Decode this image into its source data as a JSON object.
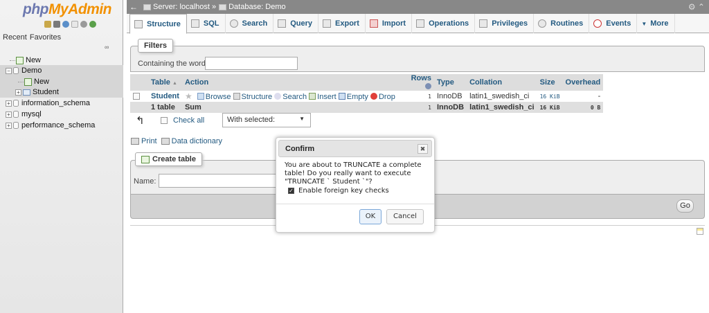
{
  "nav": {
    "logo_php": "php",
    "logo_myadmin": "MyAdmin",
    "tabs": [
      "Recent",
      "Favorites"
    ],
    "tree": {
      "new": "New",
      "demo": "Demo",
      "demo_new": "New",
      "student": "Student",
      "db1": "information_schema",
      "db2": "mysql",
      "db3": "performance_schema"
    }
  },
  "breadcrumb": {
    "server": "Server: localhost »",
    "database": "Database: Demo"
  },
  "tabs": [
    "Structure",
    "SQL",
    "Search",
    "Query",
    "Export",
    "Import",
    "Operations",
    "Privileges",
    "Routines",
    "Events",
    "More"
  ],
  "filters": {
    "legend": "Filters",
    "label": "Containing the word:",
    "value": ""
  },
  "table": {
    "headers": {
      "table": "Table",
      "sort": "▲",
      "action": "Action",
      "rows": "Rows",
      "type": "Type",
      "collation": "Collation",
      "size": "Size",
      "overhead": "Overhead"
    },
    "row": {
      "name": "Student",
      "browse": "Browse",
      "structure": "Structure",
      "search": "Search",
      "insert": "Insert",
      "empty": "Empty",
      "drop": "Drop",
      "rows": "1",
      "type": "InnoDB",
      "collation": "latin1_swedish_ci",
      "size": "16 KiB",
      "overhead": "-"
    },
    "sum": {
      "label": "1 table",
      "sum": "Sum",
      "rows": "1",
      "type": "InnoDB",
      "collation": "latin1_swedish_ci",
      "size": "16 KiB",
      "overhead": "0 B"
    }
  },
  "bulk": {
    "check_all": "Check all",
    "with_selected": "With selected:"
  },
  "links": {
    "print": "Print",
    "dictionary": "Data dictionary"
  },
  "create": {
    "legend": "Create table",
    "name_label": "Name:",
    "name_value": "",
    "go": "Go"
  },
  "modal": {
    "title": "Confirm",
    "close": "✖",
    "message": "You are about to TRUNCATE a complete table! Do you really want to execute \"TRUNCATE ` Student `\"?",
    "fk_label": "Enable foreign key checks",
    "ok": "OK",
    "cancel": "Cancel"
  },
  "colors": {
    "link": "#235a81",
    "logo_php": "#6c78af",
    "logo_myadmin": "#f29100",
    "drop": "#e0403a"
  }
}
